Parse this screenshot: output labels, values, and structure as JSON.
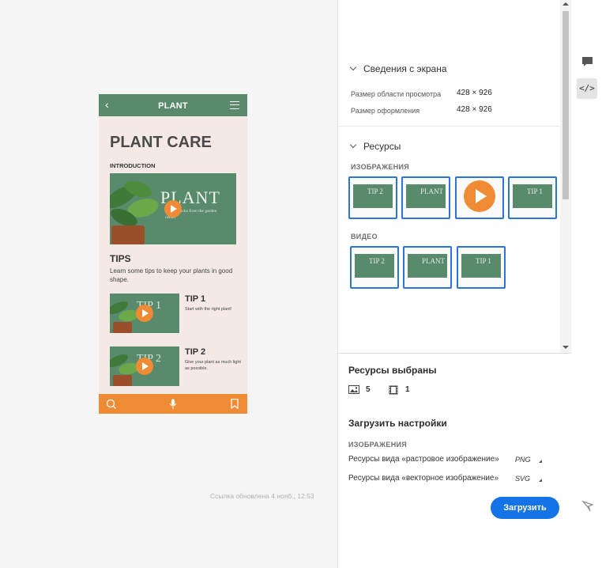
{
  "preview": {
    "phone": {
      "header_title": "PLANT",
      "page_title": "PLANT CARE",
      "intro_label": "INTRODUCTION",
      "hero_word": "PLANT",
      "hero_sub": "Tips & tricks from the garden center",
      "tips_title": "TIPS",
      "tips_desc": "Learn some tips to keep your plants in good shape.",
      "tips": [
        {
          "thumb": "TIP 1",
          "title": "TIP 1",
          "desc": "Start with the right plant!"
        },
        {
          "thumb": "TIP 2",
          "title": "TIP 2",
          "desc": "Give your plant as much light as possible."
        }
      ],
      "footer_icons": [
        "search-icon",
        "microphone-icon",
        "bookmark-icon"
      ]
    },
    "link_updated": "Ссылка обновлена 4 нояб., 12:53"
  },
  "panel": {
    "screen_info": {
      "title": "Сведения с экрана",
      "viewport_label": "Размер области просмотра",
      "viewport_value": "428 × 926",
      "design_label": "Размер оформления",
      "design_value": "428 × 926"
    },
    "resources": {
      "title": "Ресурсы",
      "images_label": "ИЗОБРАЖЕНИЯ",
      "images": [
        "TIP 2",
        "PLANT",
        "play",
        "TIP 1"
      ],
      "video_label": "ВИДЕО",
      "videos": [
        "TIP 2",
        "PLANT",
        "TIP 1"
      ]
    },
    "selected": {
      "title": "Ресурсы выбраны",
      "images_count": "5",
      "videos_count": "1"
    },
    "download": {
      "title": "Загрузить настройки",
      "sub": "ИЗОБРАЖЕНИЯ",
      "raster_label": "Ресурсы вида «растровое изображение»",
      "raster_value": "PNG",
      "vector_label": "Ресурсы вида «векторное изображение»",
      "vector_value": "SVG",
      "button": "Загрузить"
    }
  },
  "rail": {
    "code_label": "</>"
  },
  "colors": {
    "accent": "#1473e6",
    "plant_green": "#5a8a6c",
    "orange": "#ef8b35",
    "phone_bg": "#f4e9e4"
  }
}
